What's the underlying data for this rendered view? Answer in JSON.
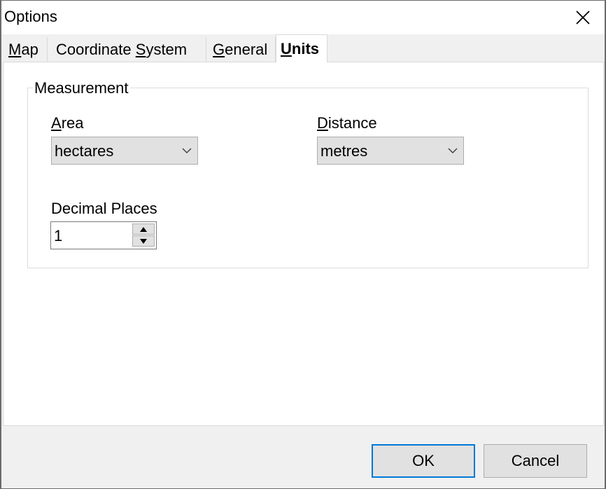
{
  "window": {
    "title": "Options",
    "close_icon": "close-x-icon"
  },
  "tabs": [
    {
      "label_pre": "",
      "accel": "M",
      "label_post": "ap",
      "active": false
    },
    {
      "label_pre": "Coordinate ",
      "accel": "S",
      "label_post": "ystem",
      "active": false
    },
    {
      "label_pre": "",
      "accel": "G",
      "label_post": "eneral",
      "active": false
    },
    {
      "label_pre": "",
      "accel": "U",
      "label_post": "nits",
      "active": true
    }
  ],
  "measurement": {
    "group_title": "Measurement",
    "area": {
      "label_accel": "A",
      "label_rest": "rea",
      "selected": "hectares"
    },
    "distance": {
      "label_accel": "D",
      "label_rest": "istance",
      "selected": "metres"
    },
    "decimal_places": {
      "label": "Decimal Places",
      "value": "1"
    }
  },
  "buttons": {
    "ok": "OK",
    "cancel": "Cancel"
  }
}
